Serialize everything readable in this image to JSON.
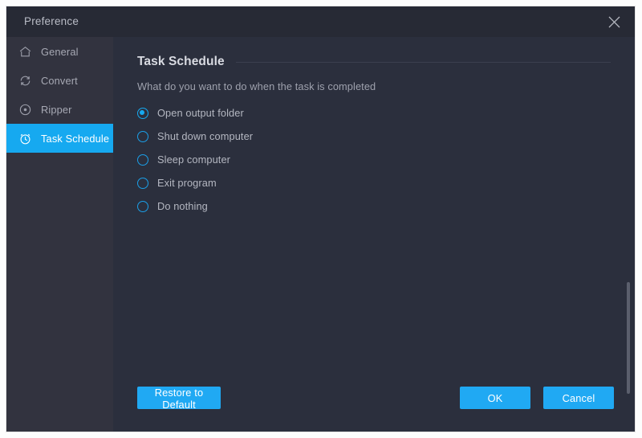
{
  "window": {
    "title": "Preference",
    "close_icon": "close-icon"
  },
  "sidebar": {
    "items": [
      {
        "label": "General",
        "icon": "home-icon",
        "active": false
      },
      {
        "label": "Convert",
        "icon": "refresh-icon",
        "active": false
      },
      {
        "label": "Ripper",
        "icon": "disc-icon",
        "active": false
      },
      {
        "label": "Task Schedule",
        "icon": "alarm-clock-icon",
        "active": true
      }
    ]
  },
  "main": {
    "section_title": "Task Schedule",
    "section_subtitle": "What do you want to do when the task is completed",
    "options": [
      {
        "label": "Open output folder",
        "checked": true
      },
      {
        "label": "Shut down computer",
        "checked": false
      },
      {
        "label": "Sleep computer",
        "checked": false
      },
      {
        "label": "Exit program",
        "checked": false
      },
      {
        "label": "Do nothing",
        "checked": false
      }
    ]
  },
  "footer": {
    "restore_label": "Restore to Default",
    "ok_label": "OK",
    "cancel_label": "Cancel"
  },
  "colors": {
    "accent": "#16a9f0",
    "button": "#20a9f3",
    "window_bg": "#2b2f3d",
    "sidebar_bg": "#32333f",
    "titlebar_bg": "#272a35"
  }
}
